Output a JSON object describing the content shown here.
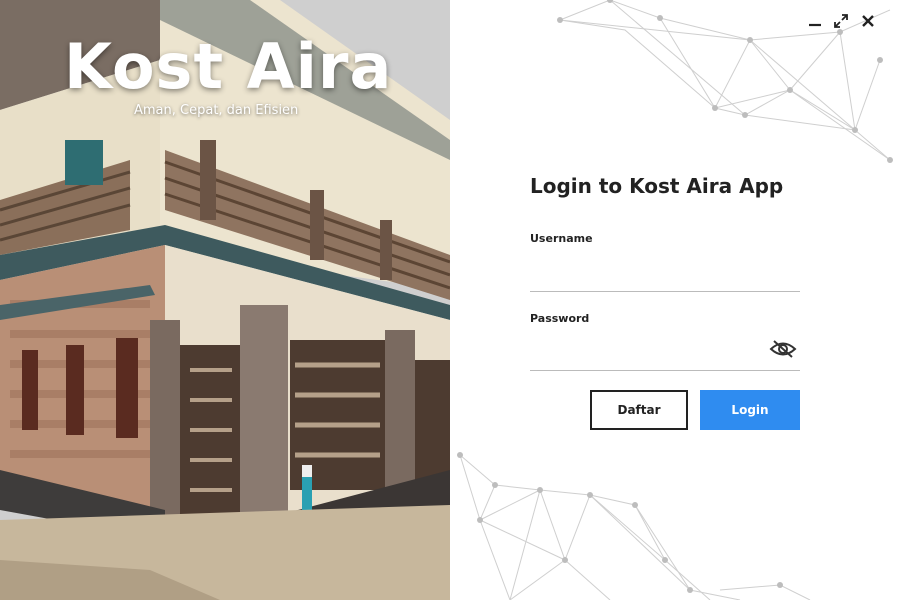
{
  "app": {
    "title": "Kost Aira",
    "tagline": "Aman, Cepat, dan Efisien"
  },
  "window_controls": {
    "minimize_icon": "minimize-icon",
    "maximize_icon": "maximize-icon",
    "close_icon": "close-icon"
  },
  "login": {
    "title": "Login to Kost Aira App",
    "username_label": "Username",
    "username_value": "",
    "password_label": "Password",
    "password_value": "",
    "toggle_icon": "eye-slash-icon",
    "register_label": "Daftar",
    "login_label": "Login"
  },
  "colors": {
    "accent": "#2f8cf0",
    "text": "#222222",
    "underline": "#bbbbbb"
  }
}
